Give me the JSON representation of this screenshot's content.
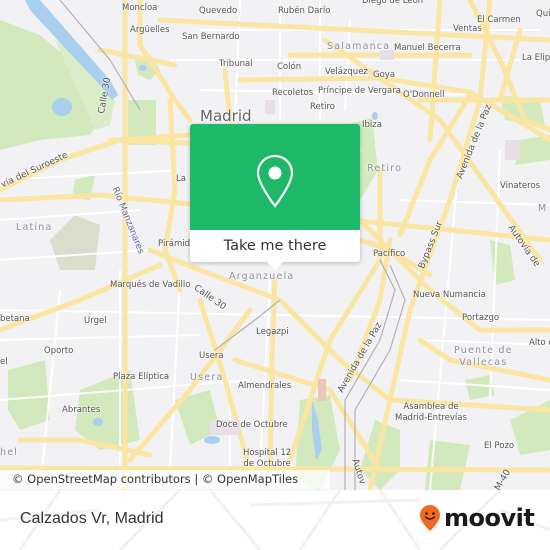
{
  "map": {
    "labels": {
      "moncloa": "Moncloa",
      "quevedo": "Quevedo",
      "ruben_dario": "Rubén Darío",
      "diego_de_leon": "Diego de León",
      "quintana": "Quint",
      "arguelles": "Argüelles",
      "san_bernardo": "San Bernardo",
      "el_carmen": "El Carmen",
      "ventas": "Ventas",
      "salamanca": "Salamanca",
      "manuel_becerra": "Manuel Becerra",
      "tribunal": "Tribunal",
      "colon": "Colón",
      "velazquez": "Velázquez",
      "goya": "Goya",
      "la_elipa": "La Elip",
      "recoletos": "Recoletos",
      "principe_de_vergara": "Príncipe de Vergara",
      "odonnell": "O'Donnell",
      "madrid": "Madrid",
      "retiro_station": "Retiro",
      "ibiza": "Ibiza",
      "calle30_north": "Calle 30",
      "avenida_del_suroeste": "vía del Suroeste",
      "la": "La",
      "retiro_district": "Retiro",
      "avenida_de_la_paz_north": "Avenida de la Paz",
      "vinateros": "Vinateros",
      "moratalaz": "M",
      "rio_manzanares": "Río Manzanares",
      "latina": "Latina",
      "piramides": "Pirámid",
      "pacifico": "Pacífico",
      "bypass_sur": "Bypass Sur",
      "autovia_del_este": "Autovía de",
      "arganzuela": "Arganzuela",
      "marques_de_vadillo": "Marqués de Vadillo",
      "calle30_south": "Calle 30",
      "nueva_numancia": "Nueva Numancia",
      "carabanchel_alto": "betana",
      "urgel": "Urgel",
      "legazpi": "Legazpi",
      "portazgo": "Portazgo",
      "oporto": "Oporto",
      "usera_station": "Usera",
      "avenida_de_la_paz_south": "Avenida de la Paz",
      "puente_de_vallecas": "Puente de\nVallecas",
      "alto": "Alto d",
      "carabanchel": "el",
      "plaza_eliptica": "Plaza Elíptica",
      "usera_district": "Usera",
      "almendrales": "Almendrales",
      "asamblea": "Asamblea de\nMadrid-Entrevías",
      "abrantes": "Abrantes",
      "doce_de_octubre": "Doce de Octubre",
      "carabanchel_district": "hel",
      "hospital": "Hospital 12\nde Octubre",
      "el_pozo": "El Pozo",
      "autovia_south": "Autov",
      "m40": "M-40"
    },
    "attribution": "© OpenStreetMap contributors | © OpenMapTiles"
  },
  "popup": {
    "icon": "map-pin-icon",
    "cta_label": "Take me there",
    "accent_color": "#1db868"
  },
  "footer": {
    "place_name": "Calzados Vr, Madrid",
    "logo_text": "moovit",
    "logo_color": "#f26a21"
  }
}
